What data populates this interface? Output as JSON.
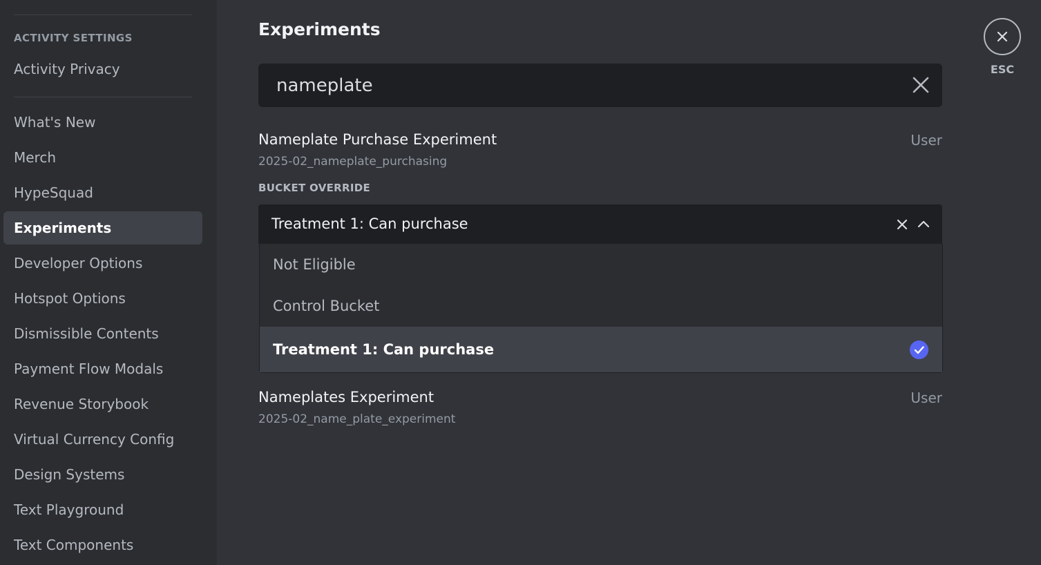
{
  "sidebar": {
    "section_header": "ACTIVITY SETTINGS",
    "items": [
      {
        "label": "Activity Privacy"
      },
      {
        "label": "What's New"
      },
      {
        "label": "Merch"
      },
      {
        "label": "HypeSquad"
      },
      {
        "label": "Experiments",
        "active": true
      },
      {
        "label": "Developer Options"
      },
      {
        "label": "Hotspot Options"
      },
      {
        "label": "Dismissible Contents"
      },
      {
        "label": "Payment Flow Modals"
      },
      {
        "label": "Revenue Storybook"
      },
      {
        "label": "Virtual Currency Config"
      },
      {
        "label": "Design Systems"
      },
      {
        "label": "Text Playground"
      },
      {
        "label": "Text Components"
      }
    ]
  },
  "main": {
    "title": "Experiments",
    "search": {
      "value": "nameplate"
    },
    "experiments": [
      {
        "name": "Nameplate Purchase Experiment",
        "id": "2025-02_nameplate_purchasing",
        "type": "User",
        "bucket_label": "BUCKET OVERRIDE",
        "selected": "Treatment 1: Can purchase",
        "options": [
          "Not Eligible",
          "Control Bucket",
          "Treatment 1: Can purchase"
        ]
      },
      {
        "name": "Nameplates Experiment",
        "id": "2025-02_name_plate_experiment",
        "type": "User"
      }
    ]
  },
  "close": {
    "label": "ESC"
  },
  "colors": {
    "accent": "#5865f2",
    "background": "#313338",
    "sidebar": "#2b2d31",
    "input": "#1e1f22"
  }
}
